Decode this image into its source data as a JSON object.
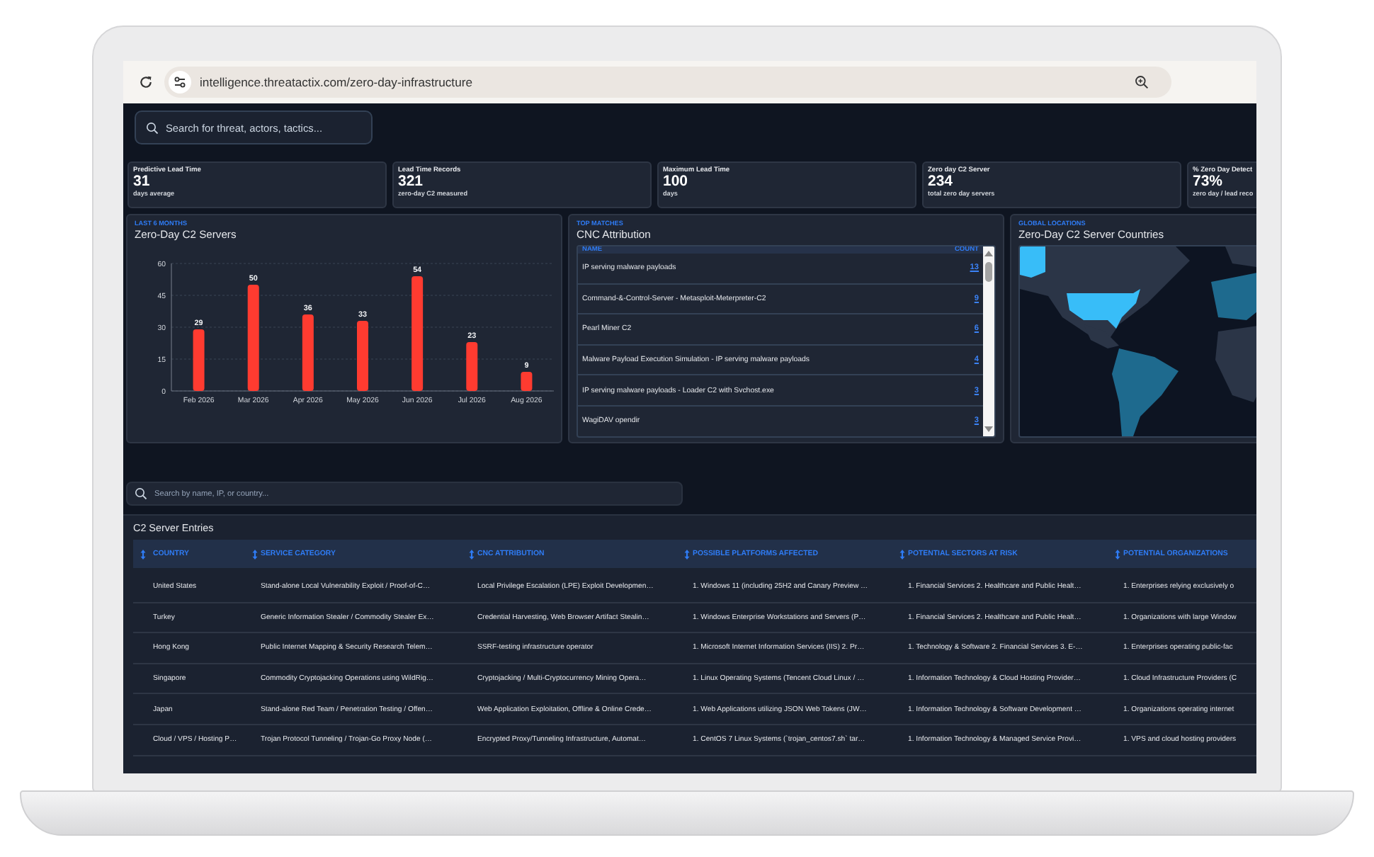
{
  "browser": {
    "url": "intelligence.threatactix.com/zero-day-infrastructure"
  },
  "search": {
    "placeholder": "Search for threat, actors, tactics..."
  },
  "stats": [
    {
      "label": "Predictive Lead Time",
      "value": "31",
      "caption": "days average"
    },
    {
      "label": "Lead Time Records",
      "value": "321",
      "caption": "zero-day C2 measured"
    },
    {
      "label": "Maximum Lead Time",
      "value": "100",
      "caption": "days"
    },
    {
      "label": "Zero day C2 Server",
      "value": "234",
      "caption": "total zero day servers"
    },
    {
      "label": "% Zero Day Detect",
      "value": "73%",
      "caption": "zero day / lead reco"
    }
  ],
  "chart_panel": {
    "eyebrow": "LAST 6 MONTHS",
    "title": "Zero-Day C2 Servers",
    "chart_data": {
      "type": "bar",
      "categories": [
        "Feb 2026",
        "Mar 2026",
        "Apr 2026",
        "May 2026",
        "Jun 2026",
        "Jul 2026",
        "Aug 2026"
      ],
      "values": [
        29,
        50,
        36,
        33,
        54,
        23,
        9
      ],
      "ylim": [
        0,
        60
      ],
      "yticks": [
        0,
        15,
        30,
        45,
        60
      ],
      "data_labels": true,
      "grid": true
    }
  },
  "cnc_panel": {
    "eyebrow": "TOP MATCHES",
    "title": "CNC Attribution",
    "columns": [
      "NAME",
      "COUNT"
    ],
    "rows": [
      {
        "name": "IP serving malware payloads",
        "count": "13"
      },
      {
        "name": "Command-&-Control-Server - Metasploit-Meterpreter-C2",
        "count": "9"
      },
      {
        "name": "Pearl Miner C2",
        "count": "6"
      },
      {
        "name": "Malware Payload Execution Simulation - IP serving malware payloads",
        "count": "4"
      },
      {
        "name": "IP serving malware payloads - Loader C2 with Svchost.exe",
        "count": "3"
      },
      {
        "name": "WagiDAV opendir",
        "count": "3"
      }
    ]
  },
  "map_panel": {
    "eyebrow": "GLOBAL LOCATIONS",
    "title": "Zero-Day C2 Server Countries"
  },
  "table_search": {
    "placeholder": "Search by name, IP, or country..."
  },
  "table": {
    "title": "C2 Server Entries",
    "columns": [
      "COUNTRY",
      "SERVICE CATEGORY",
      "CNC ATTRIBUTION",
      "POSSIBLE PLATFORMS AFFECTED",
      "POTENTIAL SECTORS AT RISK",
      "POTENTIAL ORGANIZATIONS"
    ],
    "rows": [
      [
        "United States",
        "Stand-alone Local Vulnerability Exploit / Proof-of-C…",
        "Local Privilege Escalation (LPE) Exploit Developmen…",
        "1. Windows 11 (including 25H2 and Canary Preview …",
        "1. Financial Services 2. Healthcare and Public Healt…",
        "1. Enterprises relying exclusively o"
      ],
      [
        "Turkey",
        "Generic Information Stealer / Commodity Stealer Ex…",
        "Credential Harvesting, Web Browser Artifact Stealin…",
        "1. Windows Enterprise Workstations and Servers (P…",
        "1. Financial Services 2. Healthcare and Public Healt…",
        "1. Organizations with large Window"
      ],
      [
        "Hong Kong",
        "Public Internet Mapping & Security Research Telem…",
        "SSRF-testing infrastructure operator",
        "1. Microsoft Internet Information Services (IIS) 2. Pr…",
        "1. Technology & Software 2. Financial Services 3. E-…",
        "1. Enterprises operating public-fac"
      ],
      [
        "Singapore",
        "Commodity Cryptojacking Operations using WildRig…",
        "Cryptojacking / Multi-Cryptocurrency Mining Opera…",
        "1. Linux Operating Systems (Tencent Cloud Linux / …",
        "1. Information Technology & Cloud Hosting Provider…",
        "1. Cloud Infrastructure Providers (C"
      ],
      [
        "Japan",
        "Stand-alone Red Team / Penetration Testing / Offen…",
        "Web Application Exploitation, Offline & Online Crede…",
        "1. Web Applications utilizing JSON Web Tokens (JW…",
        "1. Information Technology & Software Development …",
        "1. Organizations operating internet"
      ],
      [
        "Cloud / VPS / Hosting P…",
        "Trojan Protocol Tunneling / Trojan-Go Proxy Node (…",
        "Encrypted Proxy/Tunneling Infrastructure, Automat…",
        "1. CentOS 7 Linux Systems (`trojan_centos7.sh` tar…",
        "1. Information Technology & Managed Service Provi…",
        "1. VPS and cloud hosting providers"
      ]
    ]
  }
}
